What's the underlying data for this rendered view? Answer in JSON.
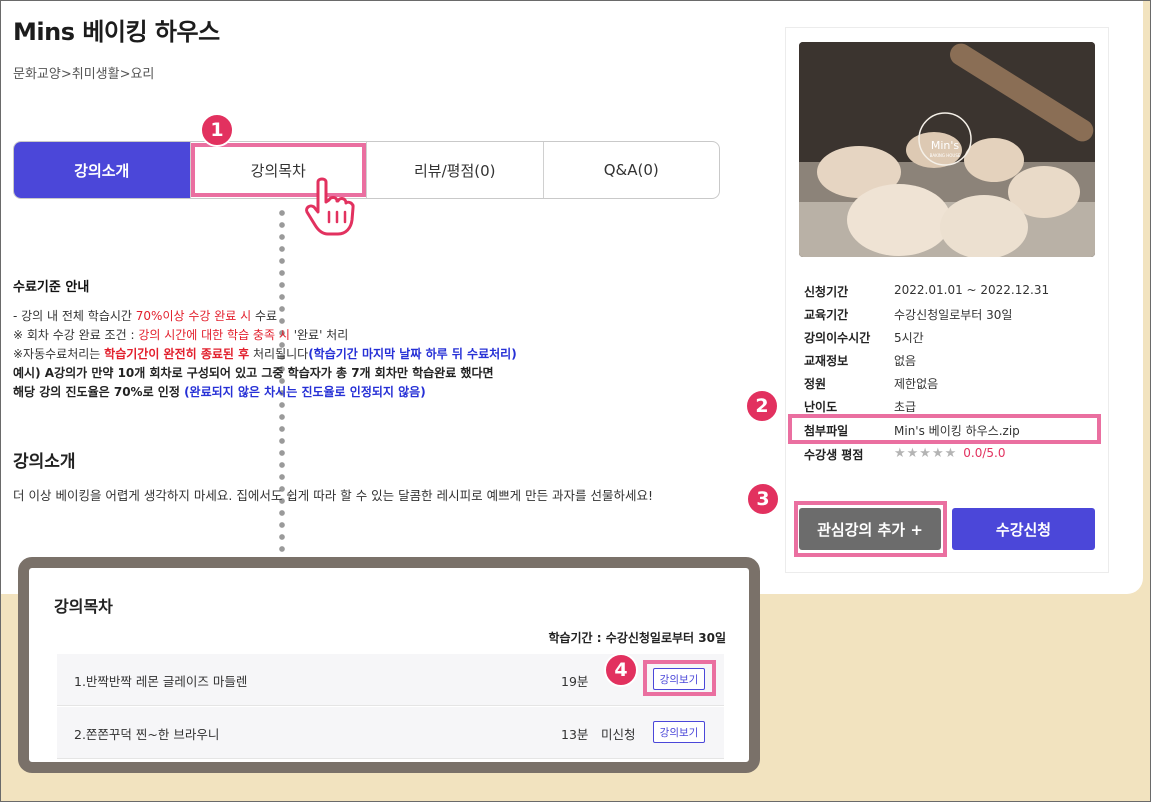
{
  "course": {
    "title": "Mins 베이킹 하우스",
    "breadcrumb": "문화교양>취미생활>요리"
  },
  "tabs": [
    {
      "label": "강의소개",
      "active": true
    },
    {
      "label": "강의목차",
      "active": false
    },
    {
      "label": "리뷰/평점(0)",
      "active": false
    },
    {
      "label": "Q&A(0)",
      "active": false
    }
  ],
  "badges": [
    "1",
    "2",
    "3",
    "4"
  ],
  "criteria": {
    "heading": "수료기준 안내",
    "line1_pre": "- 강의 내 전체 학습시간 ",
    "line1_red": "70%이상 수강 완료 시",
    "line1_post": " 수료",
    "line2_pre": "※ 회차 수강 완료 조건 : ",
    "line2_red": "강의 시간에 대한 학습 충족 시",
    "line2_post": " '완료' 처리",
    "line3_pre": "※자동수료처리는 ",
    "line3_red": "학습기간이 완전히 종료된 후",
    "line3_mid": " 처리됩니다",
    "line3_blue": "(학습기간 마지막 날짜 하루 뒤 수료처리)",
    "line4": "예시) A강의가 만약 10개 회차로 구성되어 있고 그중 학습자가 총 7개 회차만 학습완료 했다면",
    "line5_pre": "해당 강의 진도율은 70%로 인정 ",
    "line5_blue": "(완료되지 않은 차시는 진도율로 인정되지 않음)"
  },
  "intro": {
    "title": "강의소개",
    "text": "더 이상 베이킹을 어렵게 생각하지 마세요. 집에서도 쉽게 따라 할 수 있는 달콤한 레시피로 예쁘게 만든 과자를 선물하세요!"
  },
  "thumbnail": {
    "logo_text": "Min's",
    "logo_sub": "BAKING HOUSE"
  },
  "info": [
    {
      "label": "신청기간",
      "value": "2022.01.01 ~ 2022.12.31"
    },
    {
      "label": "교육기간",
      "value": "수강신청일로부터 30일"
    },
    {
      "label": "강의이수시간",
      "value": "5시간"
    },
    {
      "label": "교재정보",
      "value": "없음"
    },
    {
      "label": "정원",
      "value": "제한없음"
    },
    {
      "label": "난이도",
      "value": "초급"
    },
    {
      "label": "첨부파일",
      "value": "Min's 베이킹 하우스.zip"
    },
    {
      "label": "수강생 평점",
      "value": "★★★★★",
      "rating": "0.0/5.0"
    }
  ],
  "buttons": {
    "interest": "관심강의 추가 +",
    "enroll": "수강신청"
  },
  "toc": {
    "title": "강의목차",
    "period": "학습기간 : 수강신청일로부터 30일",
    "rows": [
      {
        "name": "1.반짝반짝 레몬 글레이즈 마들렌",
        "duration": "19분",
        "status": "",
        "button": "강의보기"
      },
      {
        "name": "2.쫀쫀꾸덕 찐~한 브라우니",
        "duration": "13분",
        "status": "미신청",
        "button": "강의보기"
      }
    ]
  },
  "colors": {
    "primary": "#4b47d9",
    "highlight": "#ea6fa0",
    "badge": "#e2315f",
    "background": "#f2e3bf"
  }
}
